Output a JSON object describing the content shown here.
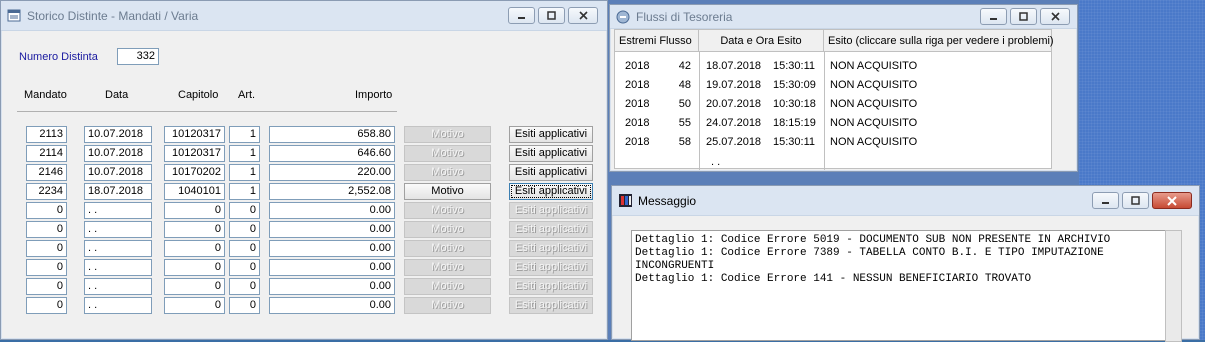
{
  "win1": {
    "title": "Storico Distinte - Mandati / Varia",
    "numero_label": "Numero Distinta",
    "numero_value": "332",
    "headers": {
      "mandato": "Mandato",
      "data": "Data",
      "capitolo": "Capitolo",
      "art": "Art.",
      "importo": "Importo"
    },
    "rows": [
      {
        "mandato": "2113",
        "data": "10.07.2018",
        "capitolo": "10120317",
        "art": "1",
        "importo": "658.80",
        "motivo": "Motivo",
        "esiti": "Esiti applicativi",
        "motivo_enabled": false,
        "esiti_enabled": true
      },
      {
        "mandato": "2114",
        "data": "10.07.2018",
        "capitolo": "10120317",
        "art": "1",
        "importo": "646.60",
        "motivo": "Motivo",
        "esiti": "Esiti applicativi",
        "motivo_enabled": false,
        "esiti_enabled": true
      },
      {
        "mandato": "2146",
        "data": "10.07.2018",
        "capitolo": "10170202",
        "art": "1",
        "importo": "220.00",
        "motivo": "Motivo",
        "esiti": "Esiti applicativi",
        "motivo_enabled": false,
        "esiti_enabled": true
      },
      {
        "mandato": "2234",
        "data": "18.07.2018",
        "capitolo": "1040101",
        "art": "1",
        "importo": "2,552.08",
        "motivo": "Motivo",
        "esiti": "Esiti applicativi",
        "motivo_enabled": true,
        "esiti_enabled": true
      },
      {
        "mandato": "0",
        "data": ". .",
        "capitolo": "0",
        "art": "0",
        "importo": "0.00",
        "motivo": "Motivo",
        "esiti": "Esiti applicativi",
        "motivo_enabled": false,
        "esiti_enabled": false
      },
      {
        "mandato": "0",
        "data": ". .",
        "capitolo": "0",
        "art": "0",
        "importo": "0.00",
        "motivo": "Motivo",
        "esiti": "Esiti applicativi",
        "motivo_enabled": false,
        "esiti_enabled": false
      },
      {
        "mandato": "0",
        "data": ". .",
        "capitolo": "0",
        "art": "0",
        "importo": "0.00",
        "motivo": "Motivo",
        "esiti": "Esiti applicativi",
        "motivo_enabled": false,
        "esiti_enabled": false
      },
      {
        "mandato": "0",
        "data": ". .",
        "capitolo": "0",
        "art": "0",
        "importo": "0.00",
        "motivo": "Motivo",
        "esiti": "Esiti applicativi",
        "motivo_enabled": false,
        "esiti_enabled": false
      },
      {
        "mandato": "0",
        "data": ". .",
        "capitolo": "0",
        "art": "0",
        "importo": "0.00",
        "motivo": "Motivo",
        "esiti": "Esiti applicativi",
        "motivo_enabled": false,
        "esiti_enabled": false
      },
      {
        "mandato": "0",
        "data": ". .",
        "capitolo": "0",
        "art": "0",
        "importo": "0.00",
        "motivo": "Motivo",
        "esiti": "Esiti applicativi",
        "motivo_enabled": false,
        "esiti_enabled": false
      }
    ]
  },
  "win2": {
    "title": "Flussi di Tesoreria",
    "headers": {
      "estremi": "Estremi Flusso",
      "data_ora": "Data e Ora Esito",
      "esito": "Esito (cliccare sulla riga per vedere i problemi)"
    },
    "rows": [
      {
        "anno": "2018",
        "num": "42",
        "data": "18.07.2018",
        "ora": "15:30:11",
        "esito": "NON ACQUISITO"
      },
      {
        "anno": "2018",
        "num": "48",
        "data": "19.07.2018",
        "ora": "15:30:09",
        "esito": "NON ACQUISITO"
      },
      {
        "anno": "2018",
        "num": "50",
        "data": "20.07.2018",
        "ora": "10:30:18",
        "esito": "NON ACQUISITO"
      },
      {
        "anno": "2018",
        "num": "55",
        "data": "24.07.2018",
        "ora": "18:15:19",
        "esito": "NON ACQUISITO"
      },
      {
        "anno": "2018",
        "num": "58",
        "data": "25.07.2018",
        "ora": "15:30:11",
        "esito": "NON ACQUISITO"
      }
    ],
    "empty_row": ". ."
  },
  "win3": {
    "title": "Messaggio",
    "lines": [
      "Dettaglio 1: Codice Errore 5019 - DOCUMENTO SUB NON PRESENTE IN ARCHIVIO",
      "Dettaglio 1: Codice Errore 7389 - TABELLA CONTO B.I. E TIPO IMPUTAZIONE",
      "INCONGRUENTI",
      "Dettaglio 1: Codice Errore 141 - NESSUN BENEFICIARIO TROVATO"
    ]
  },
  "colors": {
    "label_blue": "#1a1aa0",
    "close_red": "#c74a34",
    "field_border": "#7f9db9"
  }
}
